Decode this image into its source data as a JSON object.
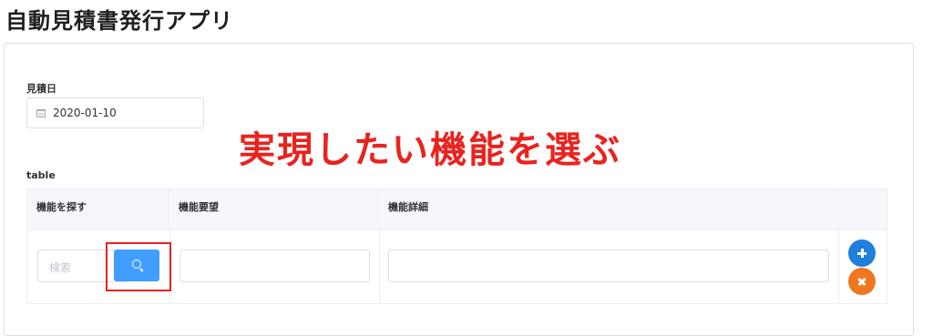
{
  "app_title": "自動見積書発行アプリ",
  "form": {
    "date_label": "見積日",
    "date_value": "2020-01-10",
    "table_label": "table"
  },
  "annotation": "実現したい機能を選ぶ",
  "table": {
    "columns": [
      "機能を探す",
      "機能要望",
      "機能詳細",
      ""
    ],
    "row": {
      "search_placeholder": "検索",
      "requirement_value": "",
      "detail_value": ""
    }
  },
  "icons": {
    "calendar": "calendar-icon",
    "search": "search-icon",
    "add": "plus-icon",
    "remove": "close-icon"
  },
  "colors": {
    "primary": "#409eff",
    "add": "#1f7fdc",
    "remove": "#f0761f",
    "annotation": "#e8231f"
  }
}
